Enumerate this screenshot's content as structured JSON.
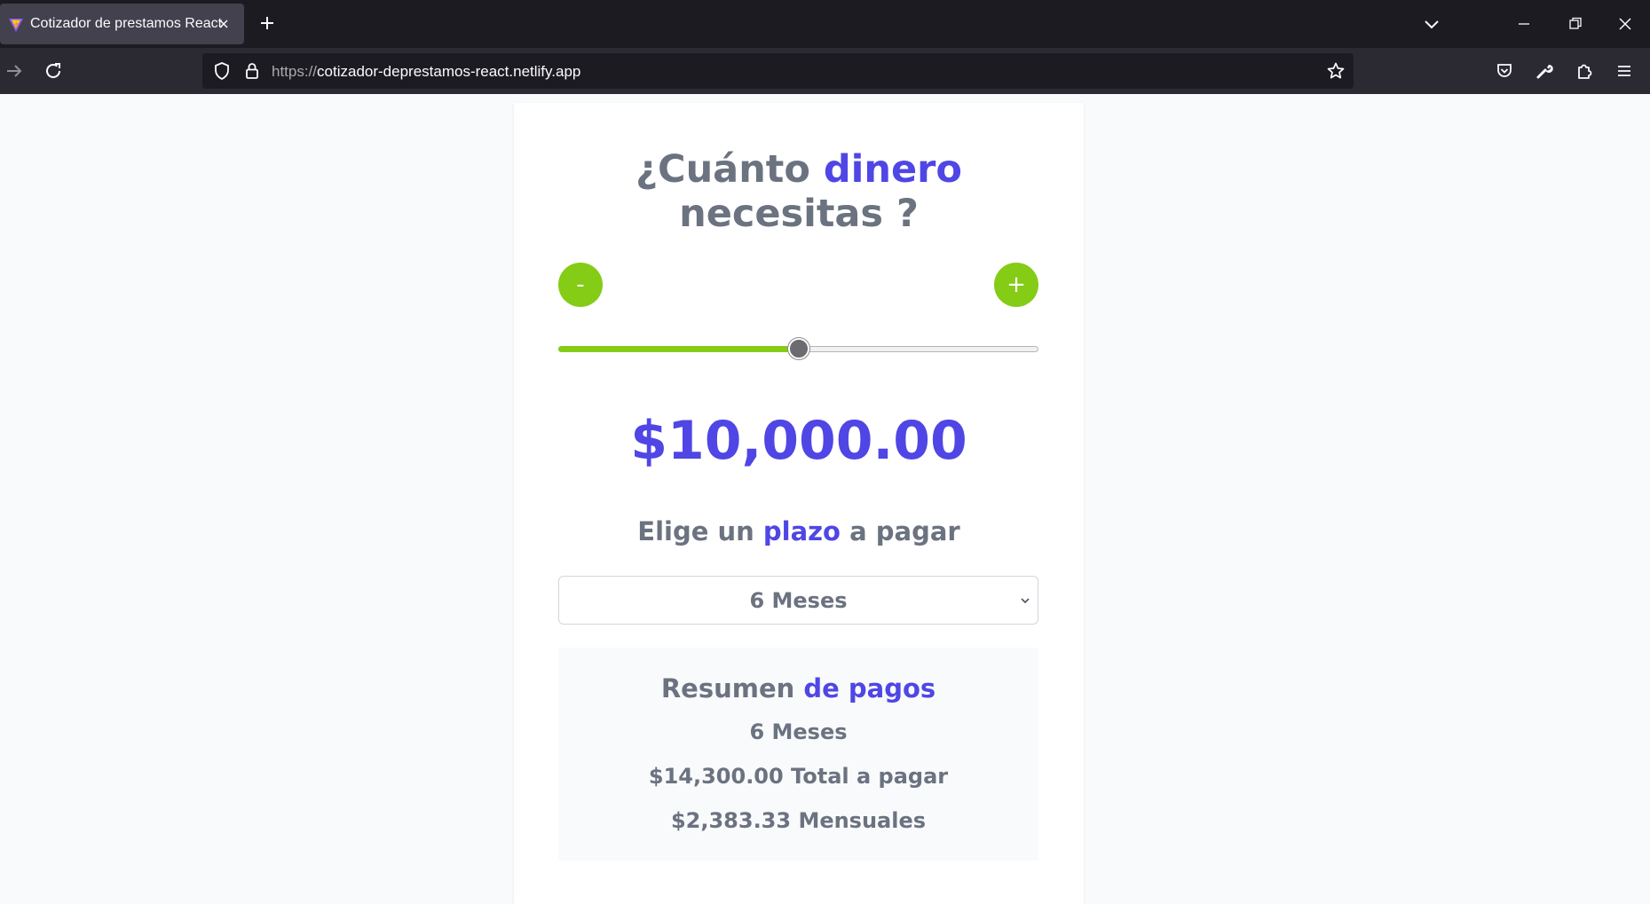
{
  "browser": {
    "tab_title": "Cotizador de prestamos React",
    "url_protocol": "https://",
    "url_host": "cotizador-deprestamos-react.netlify.app"
  },
  "app": {
    "heading": {
      "part1": "¿Cuánto",
      "accent": "dinero",
      "part2": "necesitas ?"
    },
    "minus_label": "-",
    "plus_label": "+",
    "slider_fraction": 0.5,
    "amount": "$10,000.00",
    "plazo_heading": {
      "part1": "Elige un",
      "accent": "plazo",
      "part2": "a pagar"
    },
    "plazo_selected": "6 Meses",
    "summary": {
      "title_part1": "Resumen",
      "title_accent": "de pagos",
      "months": "6 Meses",
      "total": "$14,300.00 Total a pagar",
      "monthly": "$2,383.33 Mensuales"
    }
  },
  "colors": {
    "accent": "#4f46e5",
    "button_green": "#84cc16",
    "text_gray": "#6b7280"
  }
}
